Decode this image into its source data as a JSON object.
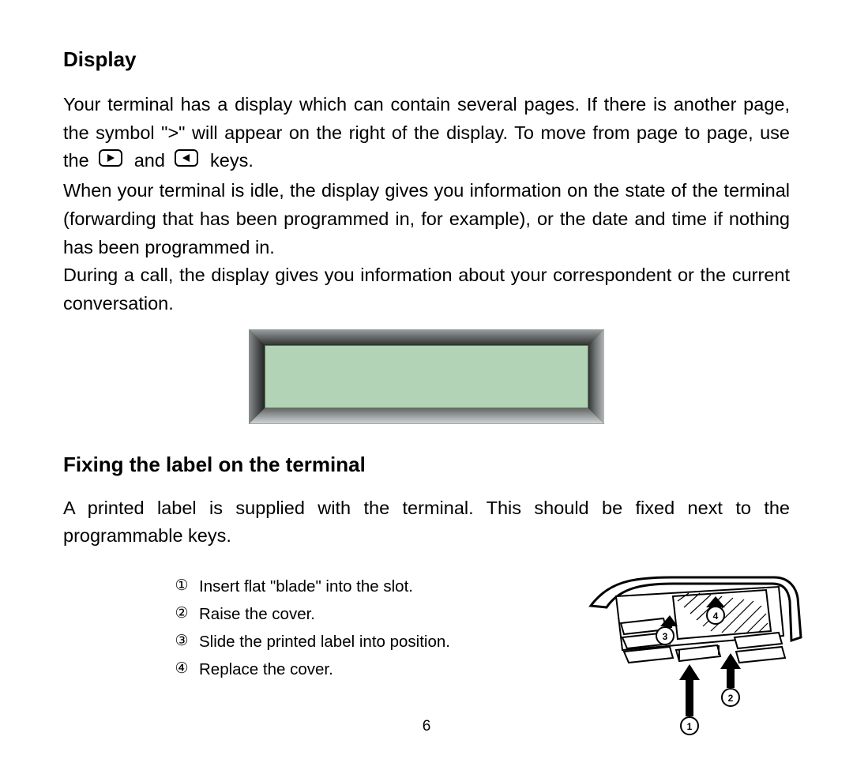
{
  "heading1": "Display",
  "para1_a": "Your terminal has a display which can contain several pages.  If there is another page, the symbol \">\" will appear on the right of the display.  To move from page to page, use the ",
  "para1_b": "  and ",
  "para1_c": "  keys.",
  "para2": "When your terminal is idle, the display gives you information on the state of the terminal (forwarding that has been programmed in, for example), or the date and time if nothing has been programmed in.",
  "para3": "During a call, the display gives you information about your correspondent or the current conversation.",
  "heading2": "Fixing the label on the terminal",
  "para4": "A printed label is supplied with the terminal. This should be fixed next to the programmable keys.",
  "steps": [
    {
      "n": "①",
      "t": "Insert flat \"blade\" into the slot."
    },
    {
      "n": "②",
      "t": "Raise the cover."
    },
    {
      "n": "③",
      "t": "Slide the printed label into position."
    },
    {
      "n": "④",
      "t": "Replace the cover."
    }
  ],
  "callouts": [
    "1",
    "2",
    "3",
    "4"
  ],
  "pageNumber": "6"
}
